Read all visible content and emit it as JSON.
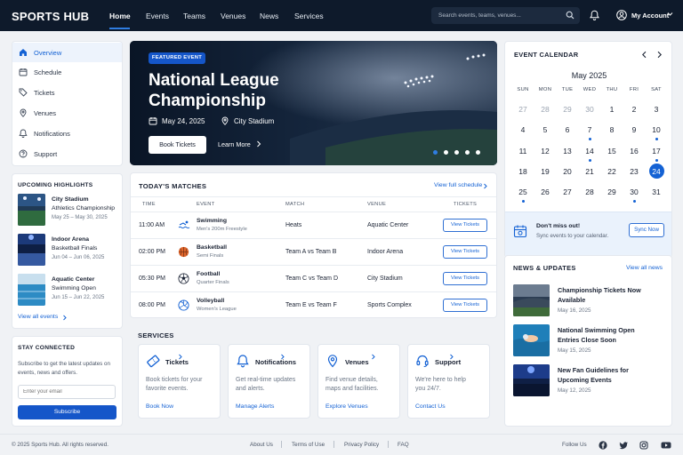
{
  "nav": {
    "brand": "SPORTS HUB",
    "links": [
      "Home",
      "Events",
      "Teams",
      "Venues",
      "News",
      "Services"
    ],
    "search_placeholder": "Search events, teams, venues...",
    "account_label": "My Account"
  },
  "sidebar": {
    "items": [
      {
        "label": "Overview",
        "icon": "home-icon"
      },
      {
        "label": "Schedule",
        "icon": "calendar-icon"
      },
      {
        "label": "Tickets",
        "icon": "ticket-icon"
      },
      {
        "label": "Venues",
        "icon": "location-pin-icon"
      },
      {
        "label": "Notifications",
        "icon": "bell-icon"
      },
      {
        "label": "Support",
        "icon": "help-circle-icon"
      }
    ]
  },
  "highlights": {
    "title": "UPCOMING HIGHLIGHTS",
    "items": [
      {
        "venue": "City Stadium",
        "event": "Athletics Championship",
        "dates": "May 25 – May 30, 2025"
      },
      {
        "venue": "Indoor Arena",
        "event": "Basketball Finals",
        "dates": "Jun 04 – Jun 06, 2025"
      },
      {
        "venue": "Aquatic Center",
        "event": "Swimming Open",
        "dates": "Jun 15 – Jun 22, 2025"
      }
    ],
    "view_all": "View all events"
  },
  "newsletter": {
    "title": "STAY CONNECTED",
    "text1": "Subscribe to get the latest updates on",
    "text2": "events, news and offers.",
    "placeholder": "Enter your email",
    "button": "Subscribe"
  },
  "hero": {
    "badge": "FEATURED EVENT",
    "title": "National League Championship",
    "date": "May 24, 2025",
    "venue": "City Stadium",
    "book_label": "Book Tickets",
    "learn_label": "Learn More",
    "active_slide": 1,
    "slide_count": 5
  },
  "matches": {
    "title": "TODAY'S MATCHES",
    "view_full": "View full schedule",
    "headers": [
      "TIME",
      "EVENT",
      "MATCH",
      "VENUE",
      "TICKETS"
    ],
    "rows": [
      {
        "time": "11:00 AM",
        "sport": "Swimming",
        "sub": "Men's 200m Freestyle",
        "match": "Heats",
        "venue": "Aquatic Center",
        "button": "View Tickets",
        "icon": "swimmer-icon"
      },
      {
        "time": "02:00 PM",
        "sport": "Basketball",
        "sub": "Semi Finals",
        "match": "Team A vs Team B",
        "venue": "Indoor Arena",
        "button": "View Tickets",
        "icon": "basketball-icon"
      },
      {
        "time": "05:30 PM",
        "sport": "Football",
        "sub": "Quarter Finals",
        "match": "Team C vs Team D",
        "venue": "City Stadium",
        "button": "View Tickets",
        "icon": "football-icon"
      },
      {
        "time": "08:00 PM",
        "sport": "Volleyball",
        "sub": "Women's League",
        "match": "Team E vs Team F",
        "venue": "Sports Complex",
        "button": "View Tickets",
        "icon": "volleyball-icon"
      }
    ]
  },
  "services": {
    "title": "SERVICES",
    "items": [
      {
        "title": "Tickets",
        "d1": "Book tickets for your",
        "d2": "favorite events.",
        "link": "Book Now",
        "icon": "ticket-icon"
      },
      {
        "title": "Notifications",
        "d1": "Get real-time updates",
        "d2": "and alerts.",
        "link": "Manage Alerts",
        "icon": "bell-icon"
      },
      {
        "title": "Venues",
        "d1": "Find venue details,",
        "d2": "maps and facilities.",
        "link": "Explore Venues",
        "icon": "location-pin-icon"
      },
      {
        "title": "Support",
        "d1": "We're here to help",
        "d2": "you 24/7.",
        "link": "Contact Us",
        "icon": "headset-icon"
      }
    ]
  },
  "calendar": {
    "title": "EVENT CALENDAR",
    "month": "May 2025",
    "weekdays": [
      "SUN",
      "MON",
      "TUE",
      "WED",
      "THU",
      "FRI",
      "SAT"
    ],
    "weeks": [
      [
        "27",
        "28",
        "29",
        "30",
        "1",
        "2",
        "3"
      ],
      [
        "4",
        "5",
        "6",
        "7",
        "8",
        "9",
        "10"
      ],
      [
        "11",
        "12",
        "13",
        "14",
        "15",
        "16",
        "17"
      ],
      [
        "18",
        "19",
        "20",
        "21",
        "22",
        "23",
        "24"
      ],
      [
        "25",
        "26",
        "27",
        "28",
        "29",
        "30",
        "31"
      ]
    ],
    "muted_leading": 4,
    "selected_day": "24",
    "event_days": [
      "7",
      "10",
      "14",
      "17",
      "25",
      "30"
    ],
    "sync_title": "Don't miss out!",
    "sync_sub": "Sync events to your calendar.",
    "sync_button": "Sync Now"
  },
  "news": {
    "title": "NEWS & UPDATES",
    "view_all": "View all news",
    "items": [
      {
        "l1": "Championship Tickets Now",
        "l2": "Available",
        "date": "May 16, 2025"
      },
      {
        "l1": "National Swimming Open",
        "l2": "Entries Close Soon",
        "date": "May 15, 2025"
      },
      {
        "l1": "New Fan Guidelines for",
        "l2": "Upcoming Events",
        "date": "May 12, 2025"
      }
    ]
  },
  "footer": {
    "copyright": "© 2025 Sports Hub. All rights reserved.",
    "links": [
      "About Us",
      "Terms of Use",
      "Privacy Policy",
      "FAQ"
    ],
    "follow": "Follow Us",
    "social": [
      "facebook-icon",
      "twitter-icon",
      "instagram-icon",
      "youtube-icon"
    ]
  },
  "colors": {
    "nav_bg": "#0e1a2b",
    "accent": "#1462d4",
    "hero_bg": "#0d1b2e"
  }
}
